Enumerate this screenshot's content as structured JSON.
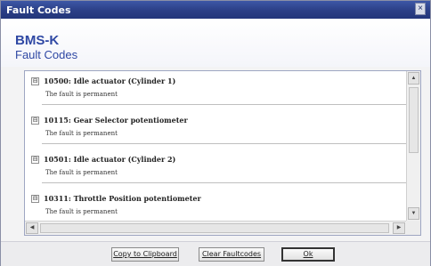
{
  "window": {
    "title": "Fault Codes",
    "close_glyph": "×"
  },
  "header": {
    "app_name": "BMS-K",
    "subtitle": "Fault Codes"
  },
  "faults": [
    {
      "code_title": "10500: Idle actuator (Cylinder 1)",
      "description": "The fault is permanent"
    },
    {
      "code_title": "10115: Gear Selector potentiometer",
      "description": "The fault is permanent"
    },
    {
      "code_title": "10501: Idle actuator (Cylinder 2)",
      "description": "The fault is permanent"
    },
    {
      "code_title": "10311: Throttle Position potentiometer",
      "description": "The fault is permanent"
    }
  ],
  "icons": {
    "expand": "⊟",
    "scroll_up": "▲",
    "scroll_down": "▼",
    "scroll_left": "◀",
    "scroll_right": "▶"
  },
  "buttons": {
    "copy": "Copy to Clipboard",
    "clear": "Clear Faultcodes",
    "ok": "Ok"
  }
}
